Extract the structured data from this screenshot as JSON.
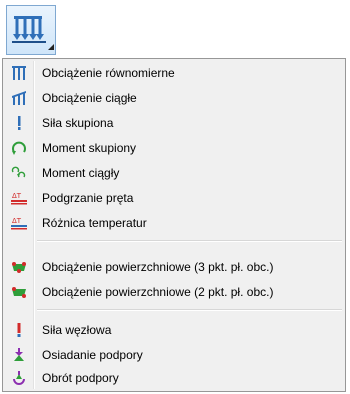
{
  "toolbar": {
    "icon": "distributed-load-dropdown-icon"
  },
  "menu": {
    "group1": [
      {
        "label": "Obciążenie równomierne",
        "icon": "uniform-load-icon"
      },
      {
        "label": "Obciążenie ciągłe",
        "icon": "continuous-load-icon"
      },
      {
        "label": "Siła skupiona",
        "icon": "point-force-icon"
      },
      {
        "label": "Moment skupiony",
        "icon": "point-moment-icon"
      },
      {
        "label": "Moment ciągły",
        "icon": "continuous-moment-icon"
      },
      {
        "label": "Podgrzanie pręta",
        "icon": "bar-heating-icon"
      },
      {
        "label": "Różnica temperatur",
        "icon": "temperature-difference-icon"
      }
    ],
    "group2": [
      {
        "label": "Obciążenie powierzchniowe (3 pkt. pł. obc.)",
        "icon": "surface-load-3pt-icon"
      },
      {
        "label": "Obciążenie powierzchniowe (2 pkt. pł. obc.)",
        "icon": "surface-load-2pt-icon"
      }
    ],
    "group3": [
      {
        "label": "Siła węzłowa",
        "icon": "nodal-force-icon"
      },
      {
        "label": "Osiadanie podpory",
        "icon": "support-settlement-icon"
      },
      {
        "label": "Obrót podpory",
        "icon": "support-rotation-icon"
      }
    ]
  },
  "colors": {
    "blue": "#2f6fb8",
    "green": "#2f9e3a",
    "red": "#d22b2b",
    "purple": "#8c2fb0"
  }
}
